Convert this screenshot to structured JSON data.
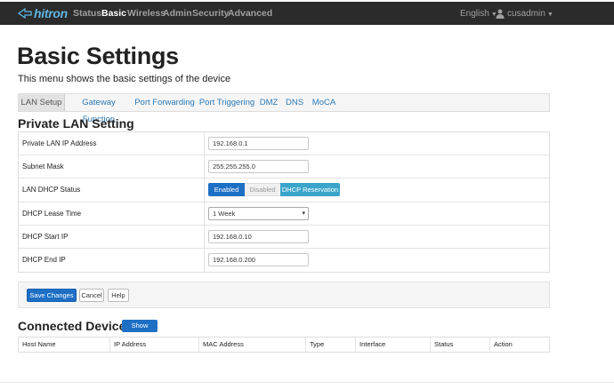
{
  "brand": {
    "name": "hitron",
    "icon": "hitron-logo-icon",
    "color": "#5fb4e0"
  },
  "nav": {
    "items": [
      {
        "label": "Status"
      },
      {
        "label": "Basic",
        "active": true
      },
      {
        "label": "Wireless"
      },
      {
        "label": "Admin"
      },
      {
        "label": "Security"
      },
      {
        "label": "Advanced"
      }
    ],
    "language": "English",
    "user": "cusadmin"
  },
  "page": {
    "title": "Basic Settings",
    "subtitle": "This menu shows the basic settings of the device"
  },
  "tabs": [
    {
      "label": "LAN Setup",
      "active": true
    },
    {
      "label": "Gateway Function"
    },
    {
      "label": "Port Forwarding"
    },
    {
      "label": "Port Triggering"
    },
    {
      "label": "DMZ"
    },
    {
      "label": "DNS"
    },
    {
      "label": "MoCA"
    }
  ],
  "lan": {
    "section_title": "Private LAN Setting",
    "ip_label": "Private LAN IP Address",
    "ip_value": "192.168.0.1",
    "mask_label": "Subnet Mask",
    "mask_value": "255.255.255.0",
    "dhcp_label": "LAN DHCP Status",
    "dhcp_options": {
      "enabled": "Enabled",
      "disabled": "Disabled",
      "reservation": "DHCP Reservation"
    },
    "dhcp_selected": "Enabled",
    "lease_label": "DHCP Lease Time",
    "lease_value": "1 Week",
    "start_label": "DHCP Start IP",
    "start_value": "192.168.0.10",
    "end_label": "DHCP End IP",
    "end_value": "192.168.0.200"
  },
  "actions": {
    "save": "Save Changes",
    "cancel": "Cancel",
    "help": "Help"
  },
  "devices": {
    "title": "Connected Devices",
    "show_button": "Show",
    "columns": [
      "Host Name",
      "IP Address",
      "MAC Address",
      "Type",
      "Interface",
      "Status",
      "Action"
    ]
  },
  "colors": {
    "navbar": "#2b2b2b",
    "primary": "#1d6fc4",
    "info": "#3aa5c9",
    "link": "#2a7ab8"
  }
}
